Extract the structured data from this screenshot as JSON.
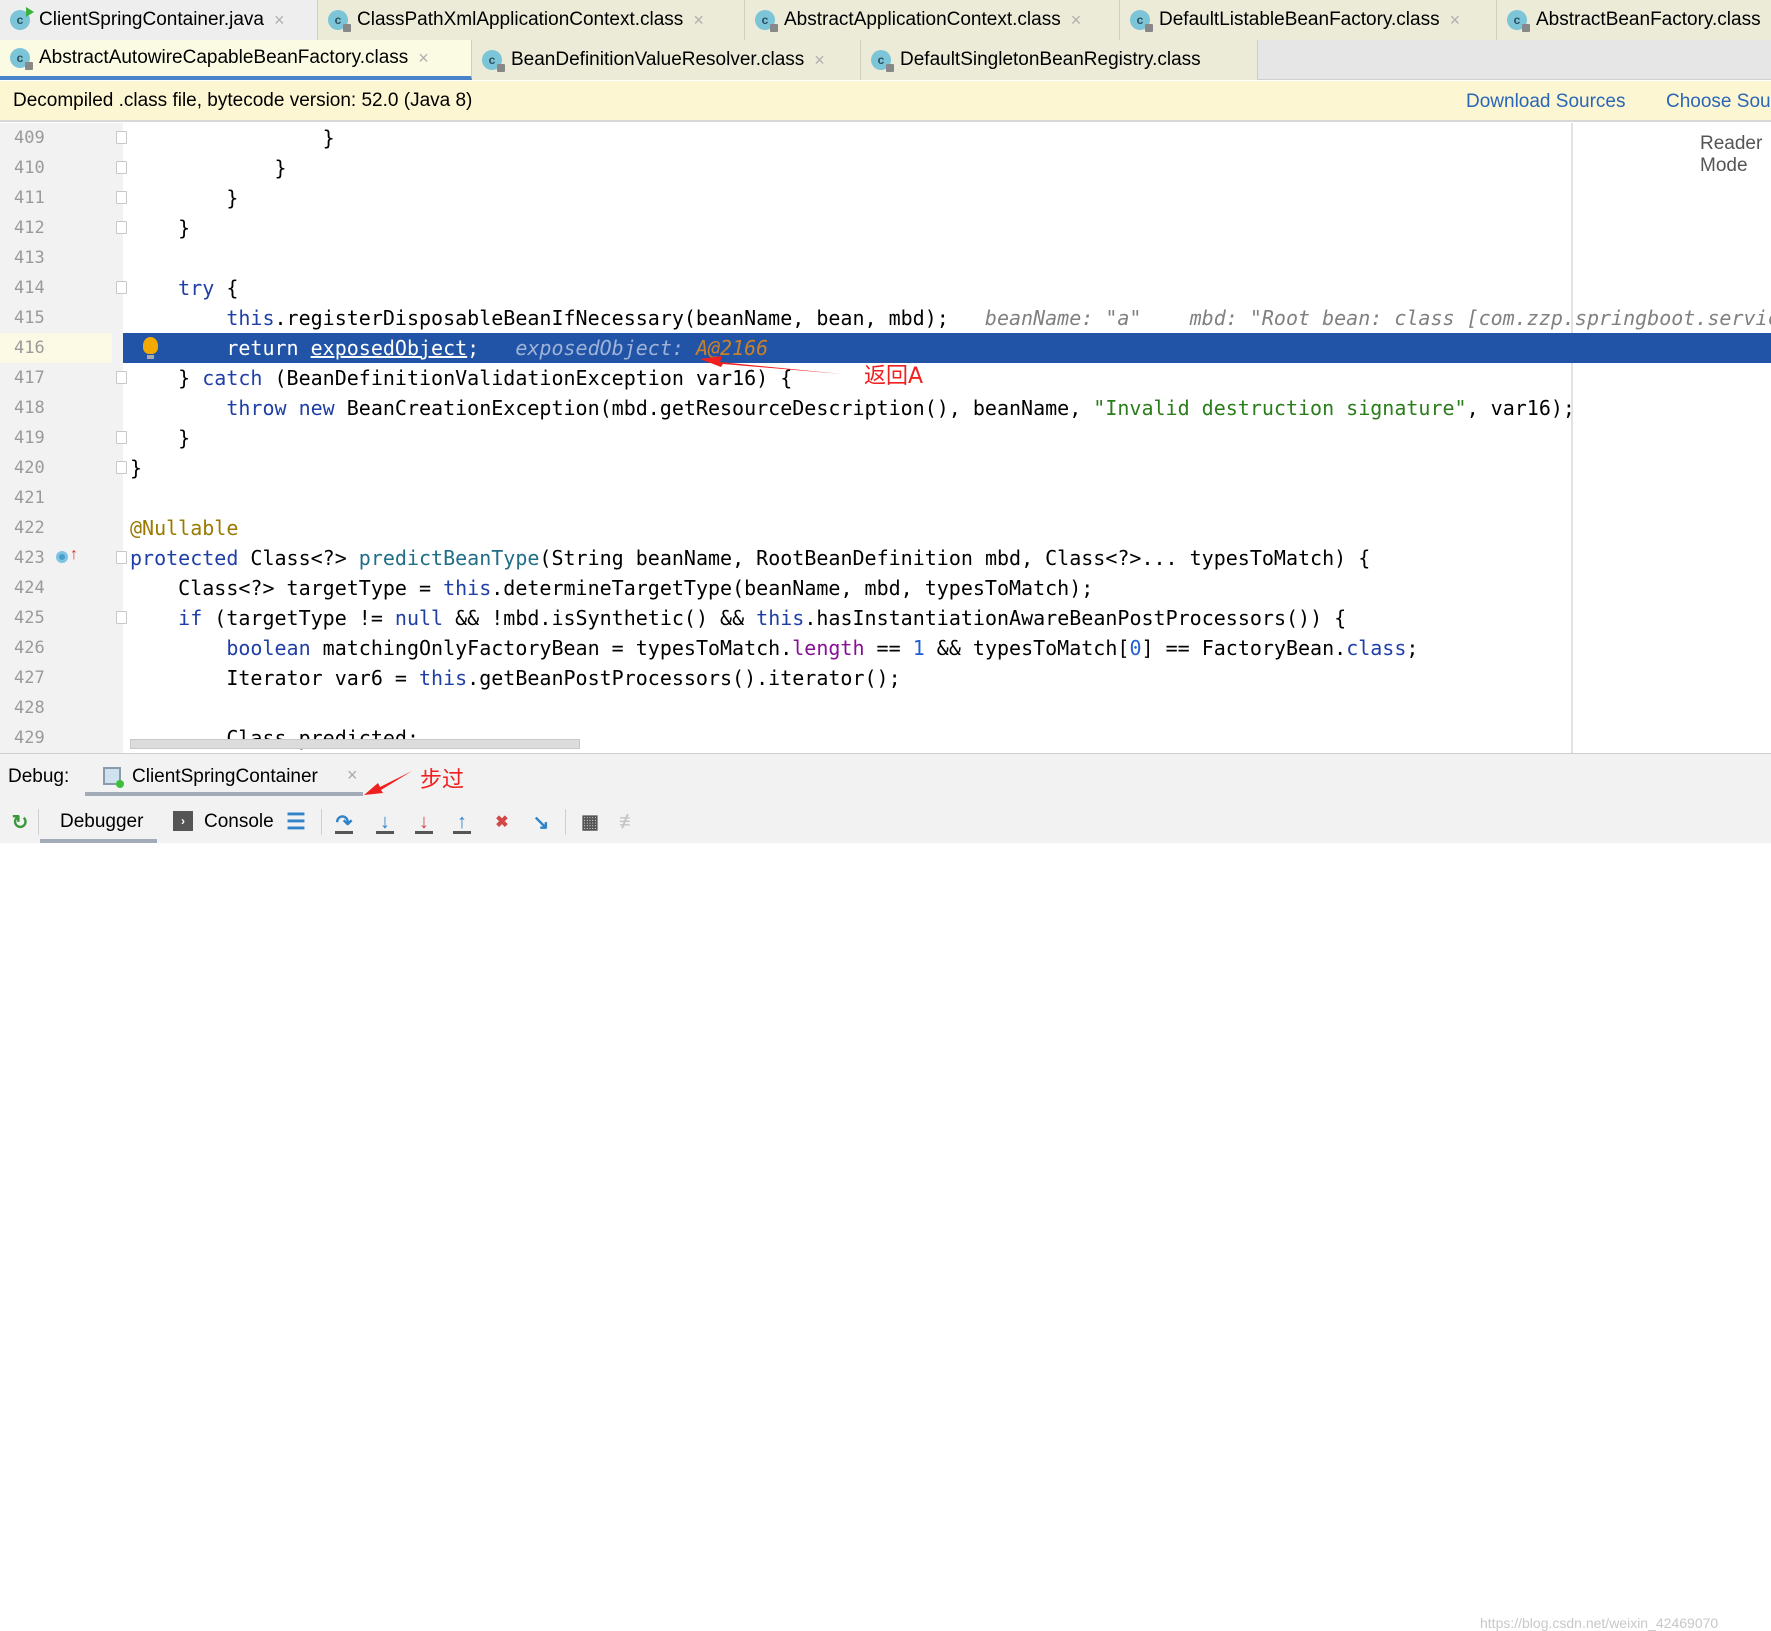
{
  "tabs_row1": [
    {
      "label": "ClientSpringContainer.java",
      "kind": "java"
    },
    {
      "label": "ClassPathXmlApplicationContext.class",
      "kind": "class"
    },
    {
      "label": "AbstractApplicationContext.class",
      "kind": "class"
    },
    {
      "label": "DefaultListableBeanFactory.class",
      "kind": "class"
    },
    {
      "label": "AbstractBeanFactory.class",
      "kind": "class"
    }
  ],
  "tabs_row2": [
    {
      "label": "AbstractAutowireCapableBeanFactory.class",
      "kind": "class",
      "active": true
    },
    {
      "label": "BeanDefinitionValueResolver.class",
      "kind": "class"
    },
    {
      "label": "DefaultSingletonBeanRegistry.class",
      "kind": "class"
    }
  ],
  "tab_icon_letter": "c",
  "tab_close": "×",
  "banner": {
    "message": "Decompiled .class file, bytecode version: 52.0 (Java 8)",
    "download_sources": "Download Sources",
    "choose_sources": "Choose Sources..."
  },
  "reader_mode": "Reader Mode",
  "current_line": "416",
  "code_lines": [
    {
      "num": "409",
      "tokens": [
        [
          "p",
          "                }"
        ]
      ]
    },
    {
      "num": "410",
      "tokens": [
        [
          "p",
          "            }"
        ]
      ]
    },
    {
      "num": "411",
      "tokens": [
        [
          "p",
          "        }"
        ]
      ]
    },
    {
      "num": "412",
      "tokens": [
        [
          "p",
          "    }"
        ]
      ]
    },
    {
      "num": "413",
      "tokens": []
    },
    {
      "num": "414",
      "tokens": [
        [
          "p",
          "    "
        ],
        [
          "kw",
          "try"
        ],
        [
          "p",
          " {"
        ]
      ]
    },
    {
      "num": "415",
      "tokens": [
        [
          "p",
          "        "
        ],
        [
          "kw",
          "this"
        ],
        [
          "p",
          ".registerDisposableBeanIfNecessary(beanName, bean, mbd);"
        ],
        [
          "hint",
          "   beanName: \"a\"    mbd: \"Root bean: class [com.zzp.springboot.service.A]"
        ]
      ]
    },
    {
      "num": "416",
      "tokens": [
        [
          "p",
          "        return "
        ],
        [
          "u",
          "exposedObject"
        ],
        [
          "p",
          ";"
        ],
        [
          "hint",
          "   exposedObject: "
        ],
        [
          "hintv",
          "A@2166"
        ]
      ]
    },
    {
      "num": "417",
      "tokens": [
        [
          "p",
          "    } "
        ],
        [
          "kw",
          "catch"
        ],
        [
          "p",
          " (BeanDefinitionValidationException var16) {"
        ]
      ]
    },
    {
      "num": "418",
      "tokens": [
        [
          "p",
          "        "
        ],
        [
          "kw",
          "throw new"
        ],
        [
          "p",
          " BeanCreationException(mbd.getResourceDescription(), beanName, "
        ],
        [
          "str",
          "\"Invalid destruction signature\""
        ],
        [
          "p",
          ", var16);"
        ]
      ]
    },
    {
      "num": "419",
      "tokens": [
        [
          "p",
          "    }"
        ]
      ]
    },
    {
      "num": "420",
      "tokens": [
        [
          "p",
          "}"
        ]
      ]
    },
    {
      "num": "421",
      "tokens": []
    },
    {
      "num": "422",
      "tokens": [
        [
          "ann",
          "@Nullable"
        ]
      ]
    },
    {
      "num": "423",
      "tokens": [
        [
          "kw",
          "protected"
        ],
        [
          "p",
          " Class<?> "
        ],
        [
          "fn",
          "predictBeanType"
        ],
        [
          "p",
          "(String beanName, RootBeanDefinition mbd, Class<?>... typesToMatch) {"
        ]
      ]
    },
    {
      "num": "424",
      "tokens": [
        [
          "p",
          "    Class<?> targetType = "
        ],
        [
          "kw",
          "this"
        ],
        [
          "p",
          ".determineTargetType(beanName, mbd, typesToMatch);"
        ]
      ]
    },
    {
      "num": "425",
      "tokens": [
        [
          "p",
          "    "
        ],
        [
          "kw",
          "if"
        ],
        [
          "p",
          " (targetType != "
        ],
        [
          "kw",
          "null"
        ],
        [
          "p",
          " && !mbd.isSynthetic() && "
        ],
        [
          "kw",
          "this"
        ],
        [
          "p",
          ".hasInstantiationAwareBeanPostProcessors()) {"
        ]
      ]
    },
    {
      "num": "426",
      "tokens": [
        [
          "p",
          "        "
        ],
        [
          "kw",
          "boolean"
        ],
        [
          "p",
          " matchingOnlyFactoryBean = typesToMatch."
        ],
        [
          "fld",
          "length"
        ],
        [
          "p",
          " == "
        ],
        [
          "num",
          "1"
        ],
        [
          "p",
          " && typesToMatch["
        ],
        [
          "num",
          "0"
        ],
        [
          "p",
          "] == FactoryBean."
        ],
        [
          "kw",
          "class"
        ],
        [
          "p",
          ";"
        ]
      ]
    },
    {
      "num": "427",
      "tokens": [
        [
          "p",
          "        Iterator var6 = "
        ],
        [
          "kw",
          "this"
        ],
        [
          "p",
          ".getBeanPostProcessors().iterator();"
        ]
      ]
    },
    {
      "num": "428",
      "tokens": []
    },
    {
      "num": "429",
      "tokens": [
        [
          "p",
          "        Class "
        ],
        [
          "u",
          "predicted"
        ],
        [
          "p",
          ";"
        ]
      ]
    }
  ],
  "fold_lines": [
    "409",
    "410",
    "411",
    "412",
    "414",
    "417",
    "419",
    "420",
    "423",
    "425"
  ],
  "debug": {
    "label": "Debug:",
    "session": "ClientSpringContainer",
    "tabs": {
      "debugger": "Debugger",
      "console": "Console"
    }
  },
  "toolbar_icons": [
    "rerun-icon",
    "console-icon",
    "layout-icon",
    "step-over-icon",
    "step-into-icon",
    "force-step-into-icon",
    "step-out-icon",
    "drop-frame-icon",
    "run-to-cursor-icon",
    "evaluate-expression-icon",
    "trace-stream-icon"
  ],
  "annotations": {
    "return_a": "返回A",
    "step_over": "步过"
  },
  "watermark": "https://blog.csdn.net/weixin_42469070",
  "colors": {
    "accent": "#2154a6",
    "annotation": "#f02020",
    "link": "#2a66b8",
    "banner_bg": "#fdf6d2"
  }
}
